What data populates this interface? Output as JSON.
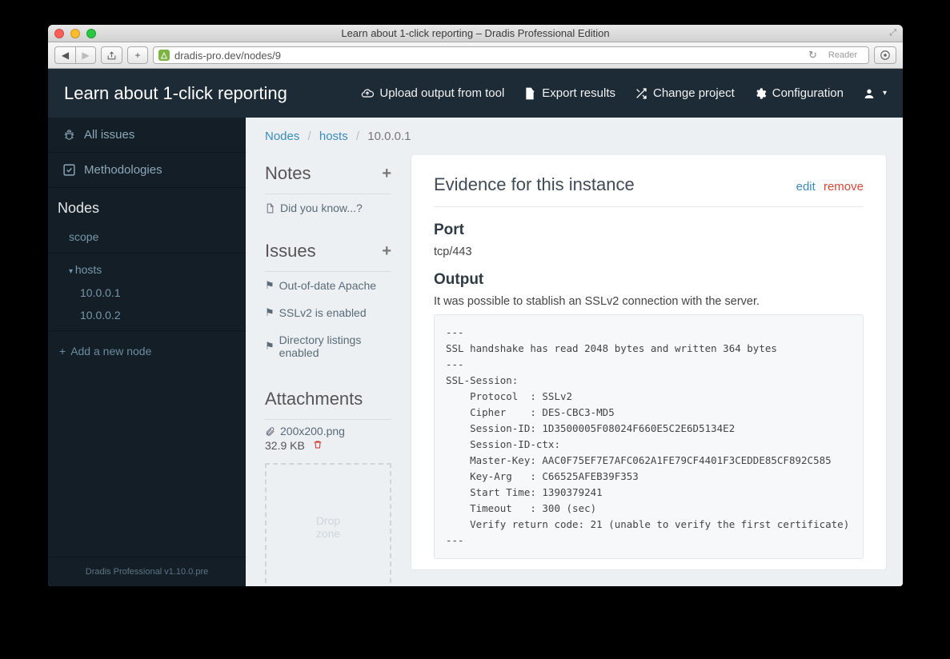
{
  "window": {
    "title": "Learn about 1-click reporting – Dradis Professional Edition",
    "url": "dradis-pro.dev/nodes/9",
    "reader_label": "Reader"
  },
  "navbar": {
    "title": "Learn about 1-click reporting",
    "links": {
      "upload": "Upload output from tool",
      "export": "Export results",
      "change_project": "Change project",
      "configuration": "Configuration"
    }
  },
  "sidebar": {
    "all_issues": "All issues",
    "methodologies": "Methodologies",
    "nodes_heading": "Nodes",
    "tree": {
      "scope": "scope",
      "hosts": "hosts",
      "children": [
        "10.0.0.1",
        "10.0.0.2"
      ]
    },
    "add_node": "Add a new node",
    "footer": "Dradis Professional v1.10.0.pre"
  },
  "breadcrumb": {
    "nodes": "Nodes",
    "hosts": "hosts",
    "current": "10.0.0.1"
  },
  "secondary": {
    "notes_heading": "Notes",
    "notes": [
      "Did you know...?"
    ],
    "issues_heading": "Issues",
    "issues": [
      "Out-of-date Apache",
      "SSLv2 is enabled",
      "Directory listings enabled"
    ],
    "attachments_heading": "Attachments",
    "attachment": {
      "name": "200x200.png",
      "size": "32.9 KB"
    },
    "dropzone": "Drop\nzone"
  },
  "content": {
    "title": "Evidence for this instance",
    "edit": "edit",
    "remove": "remove",
    "port_heading": "Port",
    "port_value": "tcp/443",
    "output_heading": "Output",
    "output_intro": "It was possible to stablish an SSLv2 connection with the server.",
    "output_block": "---\nSSL handshake has read 2048 bytes and written 364 bytes\n---\nSSL-Session:\n    Protocol  : SSLv2\n    Cipher    : DES-CBC3-MD5\n    Session-ID: 1D3500005F08024F660E5C2E6D5134E2\n    Session-ID-ctx:\n    Master-Key: AAC0F75EF7E7AFC062A1FE79CF4401F3CEDDE85CF892C585\n    Key-Arg   : C66525AFEB39F353\n    Start Time: 1390379241\n    Timeout   : 300 (sec)\n    Verify return code: 21 (unable to verify the first certificate)\n---"
  }
}
